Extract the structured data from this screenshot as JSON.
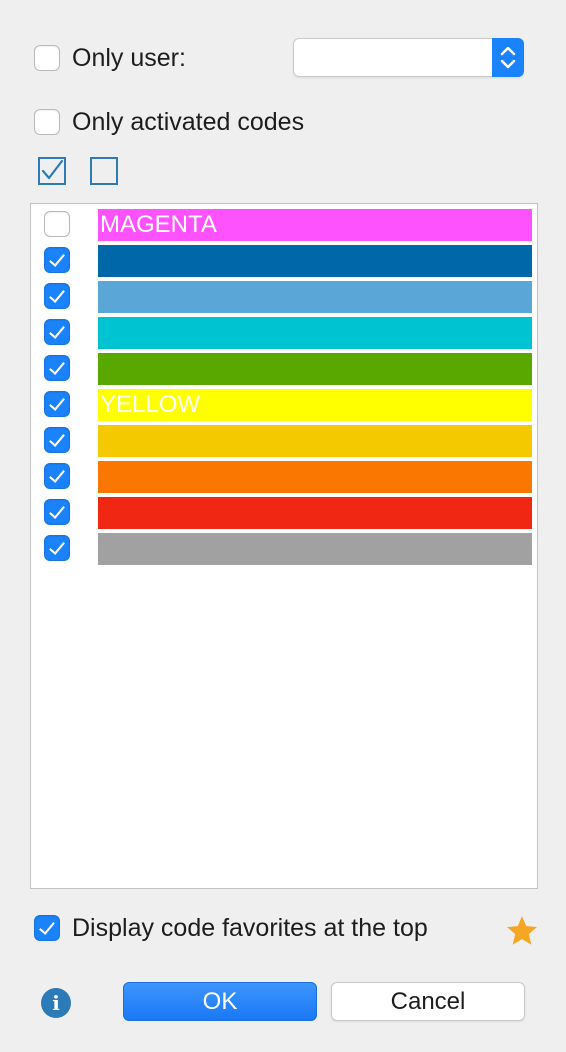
{
  "filters": {
    "only_user_label": "Only user:",
    "only_user_checked": false,
    "user_select_value": "",
    "only_activated_label": "Only activated codes",
    "only_activated_checked": false
  },
  "select_all_icon": "checked-square-icon",
  "deselect_all_icon": "empty-square-icon",
  "colors": [
    {
      "label": "MAGENTA",
      "color": "#ff52ff",
      "checked": false
    },
    {
      "label": "",
      "color": "#0067a8",
      "checked": true
    },
    {
      "label": "",
      "color": "#5aa6d7",
      "checked": true
    },
    {
      "label": "",
      "color": "#00c3d1",
      "checked": true
    },
    {
      "label": "",
      "color": "#58a800",
      "checked": true
    },
    {
      "label": "YELLOW",
      "color": "#ffff00",
      "checked": true
    },
    {
      "label": "",
      "color": "#f5c900",
      "checked": true
    },
    {
      "label": "",
      "color": "#fa7702",
      "checked": true
    },
    {
      "label": "",
      "color": "#f02712",
      "checked": true
    },
    {
      "label": "",
      "color": "#a1a1a1",
      "checked": true
    }
  ],
  "favorites": {
    "label": "Display code favorites at the top",
    "checked": true,
    "icon": "star-icon",
    "star_color": "#f5a623"
  },
  "info_icon": "info-icon",
  "info_glyph": "i",
  "buttons": {
    "ok": "OK",
    "cancel": "Cancel"
  }
}
